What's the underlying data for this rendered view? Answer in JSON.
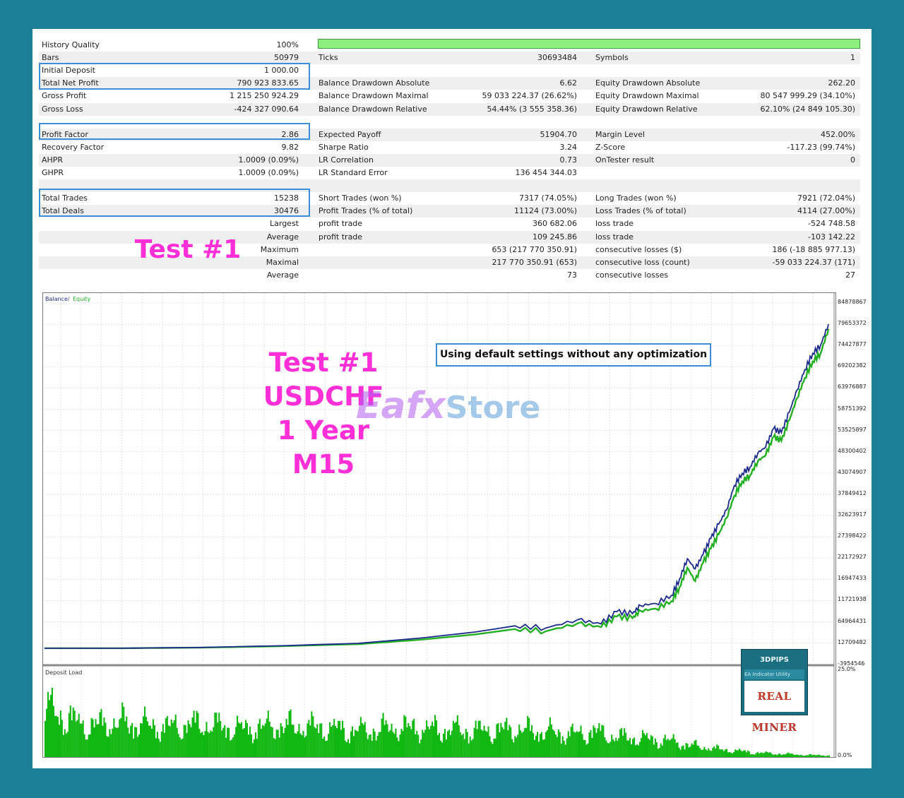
{
  "stats": {
    "rows": [
      {
        "c0": [
          "History Quality",
          "100%"
        ],
        "c1": [
          "",
          ""
        ],
        "c2": [
          "",
          ""
        ],
        "shade": false
      },
      {
        "c0": [
          "Bars",
          "50979"
        ],
        "c1": [
          "Ticks",
          "30693484"
        ],
        "c2": [
          "Symbols",
          "1"
        ],
        "shade": true
      },
      {
        "c0": [
          "Initial Deposit",
          "1 000.00"
        ],
        "c1": [
          "",
          ""
        ],
        "c2": [
          "",
          ""
        ],
        "shade": false
      },
      {
        "c0": [
          "Total Net Profit",
          "790 923 833.65"
        ],
        "c1": [
          "Balance Drawdown Absolute",
          "6.62"
        ],
        "c2": [
          "Equity Drawdown Absolute",
          "262.20"
        ],
        "shade": true
      },
      {
        "c0": [
          "Gross Profit",
          "1 215 250 924.29"
        ],
        "c1": [
          "Balance Drawdown Maximal",
          "59 033 224.37 (26.62%)"
        ],
        "c2": [
          "Equity Drawdown Maximal",
          "80 547 999.29 (34.10%)"
        ],
        "shade": false
      },
      {
        "c0": [
          "Gross Loss",
          "-424 327 090.64"
        ],
        "c1": [
          "Balance Drawdown Relative",
          "54.44% (3 555 358.36)"
        ],
        "c2": [
          "Equity Drawdown Relative",
          "62.10% (24 849 105.30)"
        ],
        "shade": true
      },
      {
        "c0": [
          "",
          ""
        ],
        "c1": [
          "",
          ""
        ],
        "c2": [
          "",
          ""
        ],
        "shade": false
      },
      {
        "c0": [
          "Profit Factor",
          "2.86"
        ],
        "c1": [
          "Expected Payoff",
          "51904.70"
        ],
        "c2": [
          "Margin Level",
          "452.00%"
        ],
        "shade": true
      },
      {
        "c0": [
          "Recovery Factor",
          "9.82"
        ],
        "c1": [
          "Sharpe Ratio",
          "3.24"
        ],
        "c2": [
          "Z-Score",
          "-117.23 (99.74%)"
        ],
        "shade": false
      },
      {
        "c0": [
          "AHPR",
          "1.0009 (0.09%)"
        ],
        "c1": [
          "LR Correlation",
          "0.73"
        ],
        "c2": [
          "OnTester result",
          "0"
        ],
        "shade": true
      },
      {
        "c0": [
          "GHPR",
          "1.0009 (0.09%)"
        ],
        "c1": [
          "LR Standard Error",
          "136 454 344.03"
        ],
        "c2": [
          "",
          ""
        ],
        "shade": false
      },
      {
        "c0": [
          "",
          ""
        ],
        "c1": [
          "",
          ""
        ],
        "c2": [
          "",
          ""
        ],
        "shade": true
      },
      {
        "c0": [
          "Total Trades",
          "15238"
        ],
        "c1": [
          "Short Trades (won %)",
          "7317 (74.05%)"
        ],
        "c2": [
          "Long Trades (won %)",
          "7921 (72.04%)"
        ],
        "shade": false
      },
      {
        "c0": [
          "Total Deals",
          "30476"
        ],
        "c1": [
          "Profit Trades (% of total)",
          "11124 (73.00%)"
        ],
        "c2": [
          "Loss Trades (% of total)",
          "4114 (27.00%)"
        ],
        "shade": true
      },
      {
        "c0": [
          "",
          "Largest"
        ],
        "c1": [
          "profit trade",
          "360 682.06"
        ],
        "c2": [
          "loss trade",
          "-524 748.58"
        ],
        "shade": false
      },
      {
        "c0": [
          "",
          "Average"
        ],
        "c1": [
          "profit trade",
          "109 245.86"
        ],
        "c2": [
          "loss trade",
          "-103 142.22"
        ],
        "shade": true
      },
      {
        "c0": [
          "",
          "Maximum"
        ],
        "c1": [
          "",
          "653 (217 770 350.91)"
        ],
        "c2": [
          "consecutive losses ($)",
          "186 (-18 885 977.13)"
        ],
        "shade": false
      },
      {
        "c0": [
          "",
          "Maximal"
        ],
        "c1": [
          "",
          "217 770 350.91 (653)"
        ],
        "c2": [
          "consecutive loss (count)",
          "-59 033 224.37 (171)"
        ],
        "shade": true
      },
      {
        "c0": [
          "",
          "Average"
        ],
        "c1": [
          "",
          "73"
        ],
        "c2": [
          "consecutive losses",
          "27"
        ],
        "shade": false
      }
    ],
    "history_quality_fill": 1.0
  },
  "overlay": {
    "test_label": "Test #1",
    "center_lines": [
      "Test #1",
      "USDCHF",
      "1 Year",
      "M15"
    ],
    "note": "Using default settings without any optimization",
    "watermark_a": "Eafx",
    "watermark_b": "Store"
  },
  "badge": {
    "brand": "3DPIPS",
    "tags": "EA  Indicator  Utility",
    "product": "REAL MINER"
  },
  "colors": {
    "balance": "#1c2a8c",
    "equity": "#22b022",
    "deposit_load": "#12b812",
    "accent_pink": "#ff2fd8",
    "highlight_box": "#3a8fd8"
  },
  "chart_data": [
    {
      "type": "line",
      "legend": [
        "Balance",
        "Equity"
      ],
      "legend_separator": "/",
      "y_ticks": [
        "84878867",
        "79653372",
        "74427877",
        "69202382",
        "63976887",
        "58751392",
        "53525897",
        "48300402",
        "43074907",
        "37849412",
        "32623917",
        "27398422",
        "22172927",
        "16947433",
        "11721938",
        "64964431",
        "12709482",
        "-3954546"
      ],
      "ylim": [
        -3954546,
        84878867
      ],
      "x": [
        0,
        0.1,
        0.2,
        0.3,
        0.4,
        0.48,
        0.55,
        0.6,
        0.64,
        0.68,
        0.71,
        0.73,
        0.75,
        0.76,
        0.78,
        0.8,
        0.81,
        0.82,
        0.83,
        0.84,
        0.85,
        0.86,
        0.87,
        0.88,
        0.89,
        0.9,
        0.91,
        0.92,
        0.93,
        0.94,
        0.95,
        0.96,
        0.97,
        0.98,
        0.99,
        1.0
      ],
      "series": [
        {
          "name": "Balance",
          "values": [
            1000,
            1000,
            200000,
            600000,
            1200000,
            2500000,
            4000000,
            5500000,
            5000000,
            7000000,
            6000000,
            9000000,
            8500000,
            10500000,
            11000000,
            13000000,
            17000000,
            22000000,
            19500000,
            23000000,
            27000000,
            30500000,
            34000000,
            40000000,
            43000000,
            44500000,
            48000000,
            49500000,
            54000000,
            53000000,
            58000000,
            63500000,
            68500000,
            72500000,
            74500000,
            79653372
          ]
        },
        {
          "name": "Equity",
          "values": [
            1000,
            900,
            150000,
            500000,
            1000000,
            2100000,
            3400000,
            4700000,
            4200000,
            6100000,
            5200000,
            7800000,
            7400000,
            9200000,
            9700000,
            11600000,
            15000000,
            19800000,
            16500000,
            21000000,
            24500000,
            28000000,
            32000000,
            37500000,
            41000000,
            42500000,
            46000000,
            47500000,
            52000000,
            51000000,
            56000000,
            61500000,
            66500000,
            70500000,
            72500000,
            78500000
          ]
        }
      ]
    },
    {
      "type": "bar",
      "title": "Deposit Load",
      "y_ticks": [
        "25.0%",
        "0.0%"
      ],
      "ylim": [
        0,
        25
      ],
      "profile": [
        [
          0.0,
          14.0
        ],
        [
          0.05,
          9.0
        ],
        [
          0.1,
          10.0
        ],
        [
          0.15,
          8.5
        ],
        [
          0.2,
          9.5
        ],
        [
          0.25,
          8.0
        ],
        [
          0.3,
          9.0
        ],
        [
          0.35,
          8.5
        ],
        [
          0.4,
          7.5
        ],
        [
          0.45,
          8.5
        ],
        [
          0.5,
          8.0
        ],
        [
          0.55,
          7.5
        ],
        [
          0.6,
          8.0
        ],
        [
          0.65,
          7.0
        ],
        [
          0.68,
          6.5
        ],
        [
          0.7,
          7.5
        ],
        [
          0.72,
          6.0
        ],
        [
          0.75,
          5.5
        ],
        [
          0.78,
          5.0
        ],
        [
          0.8,
          4.5
        ],
        [
          0.82,
          3.5
        ],
        [
          0.85,
          2.5
        ],
        [
          0.88,
          1.8
        ],
        [
          0.91,
          1.2
        ],
        [
          0.94,
          0.9
        ],
        [
          0.97,
          0.6
        ],
        [
          1.0,
          0.5
        ]
      ]
    }
  ]
}
